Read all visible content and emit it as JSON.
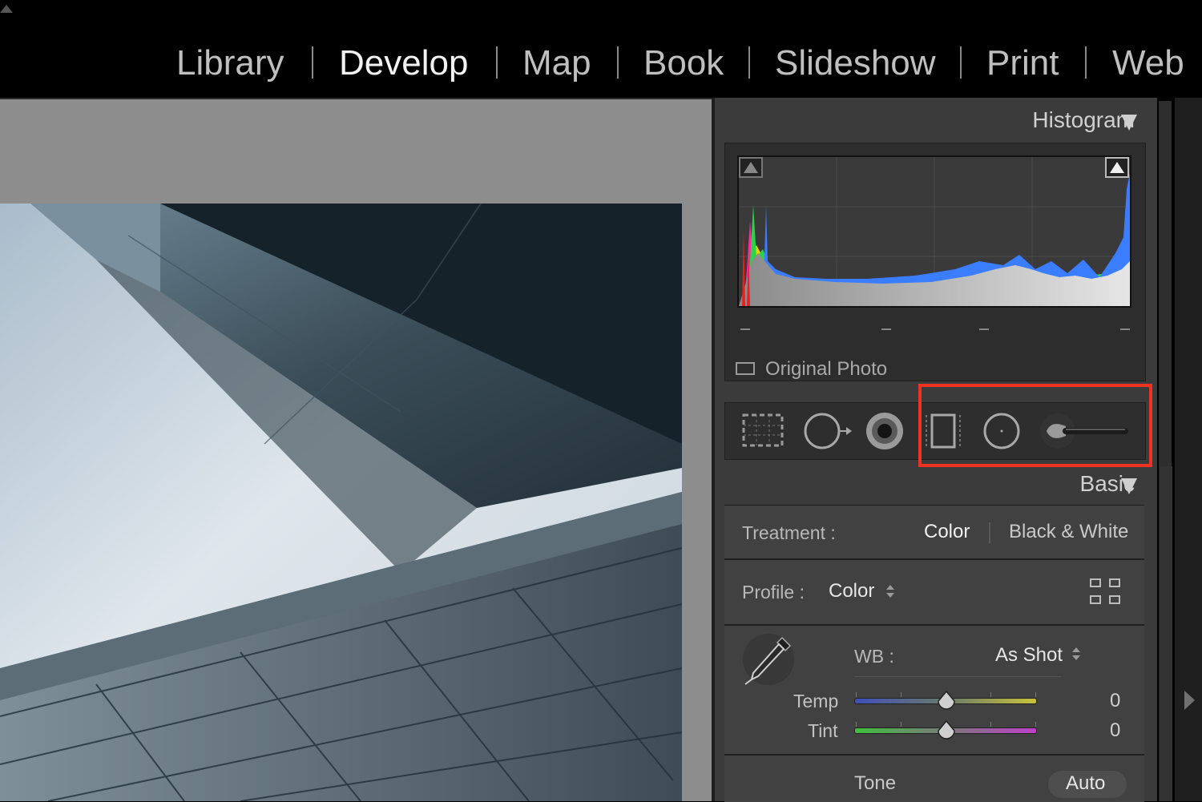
{
  "modules": [
    {
      "label": "Library",
      "active": false
    },
    {
      "label": "Develop",
      "active": true
    },
    {
      "label": "Map",
      "active": false
    },
    {
      "label": "Book",
      "active": false
    },
    {
      "label": "Slideshow",
      "active": false
    },
    {
      "label": "Print",
      "active": false
    },
    {
      "label": "Web",
      "active": false
    }
  ],
  "histogram": {
    "title": "Histogram",
    "original_photo_label": "Original Photo",
    "original_photo_checked": false,
    "shadow_clipping_on": false,
    "highlight_clipping_on": true
  },
  "tools": {
    "items": [
      "crop-overlay-icon",
      "spot-removal-icon",
      "red-eye-icon",
      "graduated-filter-icon",
      "radial-filter-icon",
      "adjustment-brush-icon"
    ],
    "highlight_color": "#ee3322"
  },
  "basic": {
    "title": "Basic",
    "treatment_label": "Treatment :",
    "treatment_color": "Color",
    "treatment_bw": "Black & White",
    "profile_label": "Profile :",
    "profile_value": "Color",
    "wb_label": "WB :",
    "wb_value": "As Shot",
    "temp_label": "Temp",
    "temp_value": "0",
    "tint_label": "Tint",
    "tint_value": "0",
    "tone_label": "Tone",
    "auto_label": "Auto"
  },
  "colors": {
    "panel_bg": "#3b3b3b",
    "canvas_bg": "#8d8d8d",
    "active_module": "#f2f2f2",
    "inactive_module": "#bfbfbf"
  }
}
